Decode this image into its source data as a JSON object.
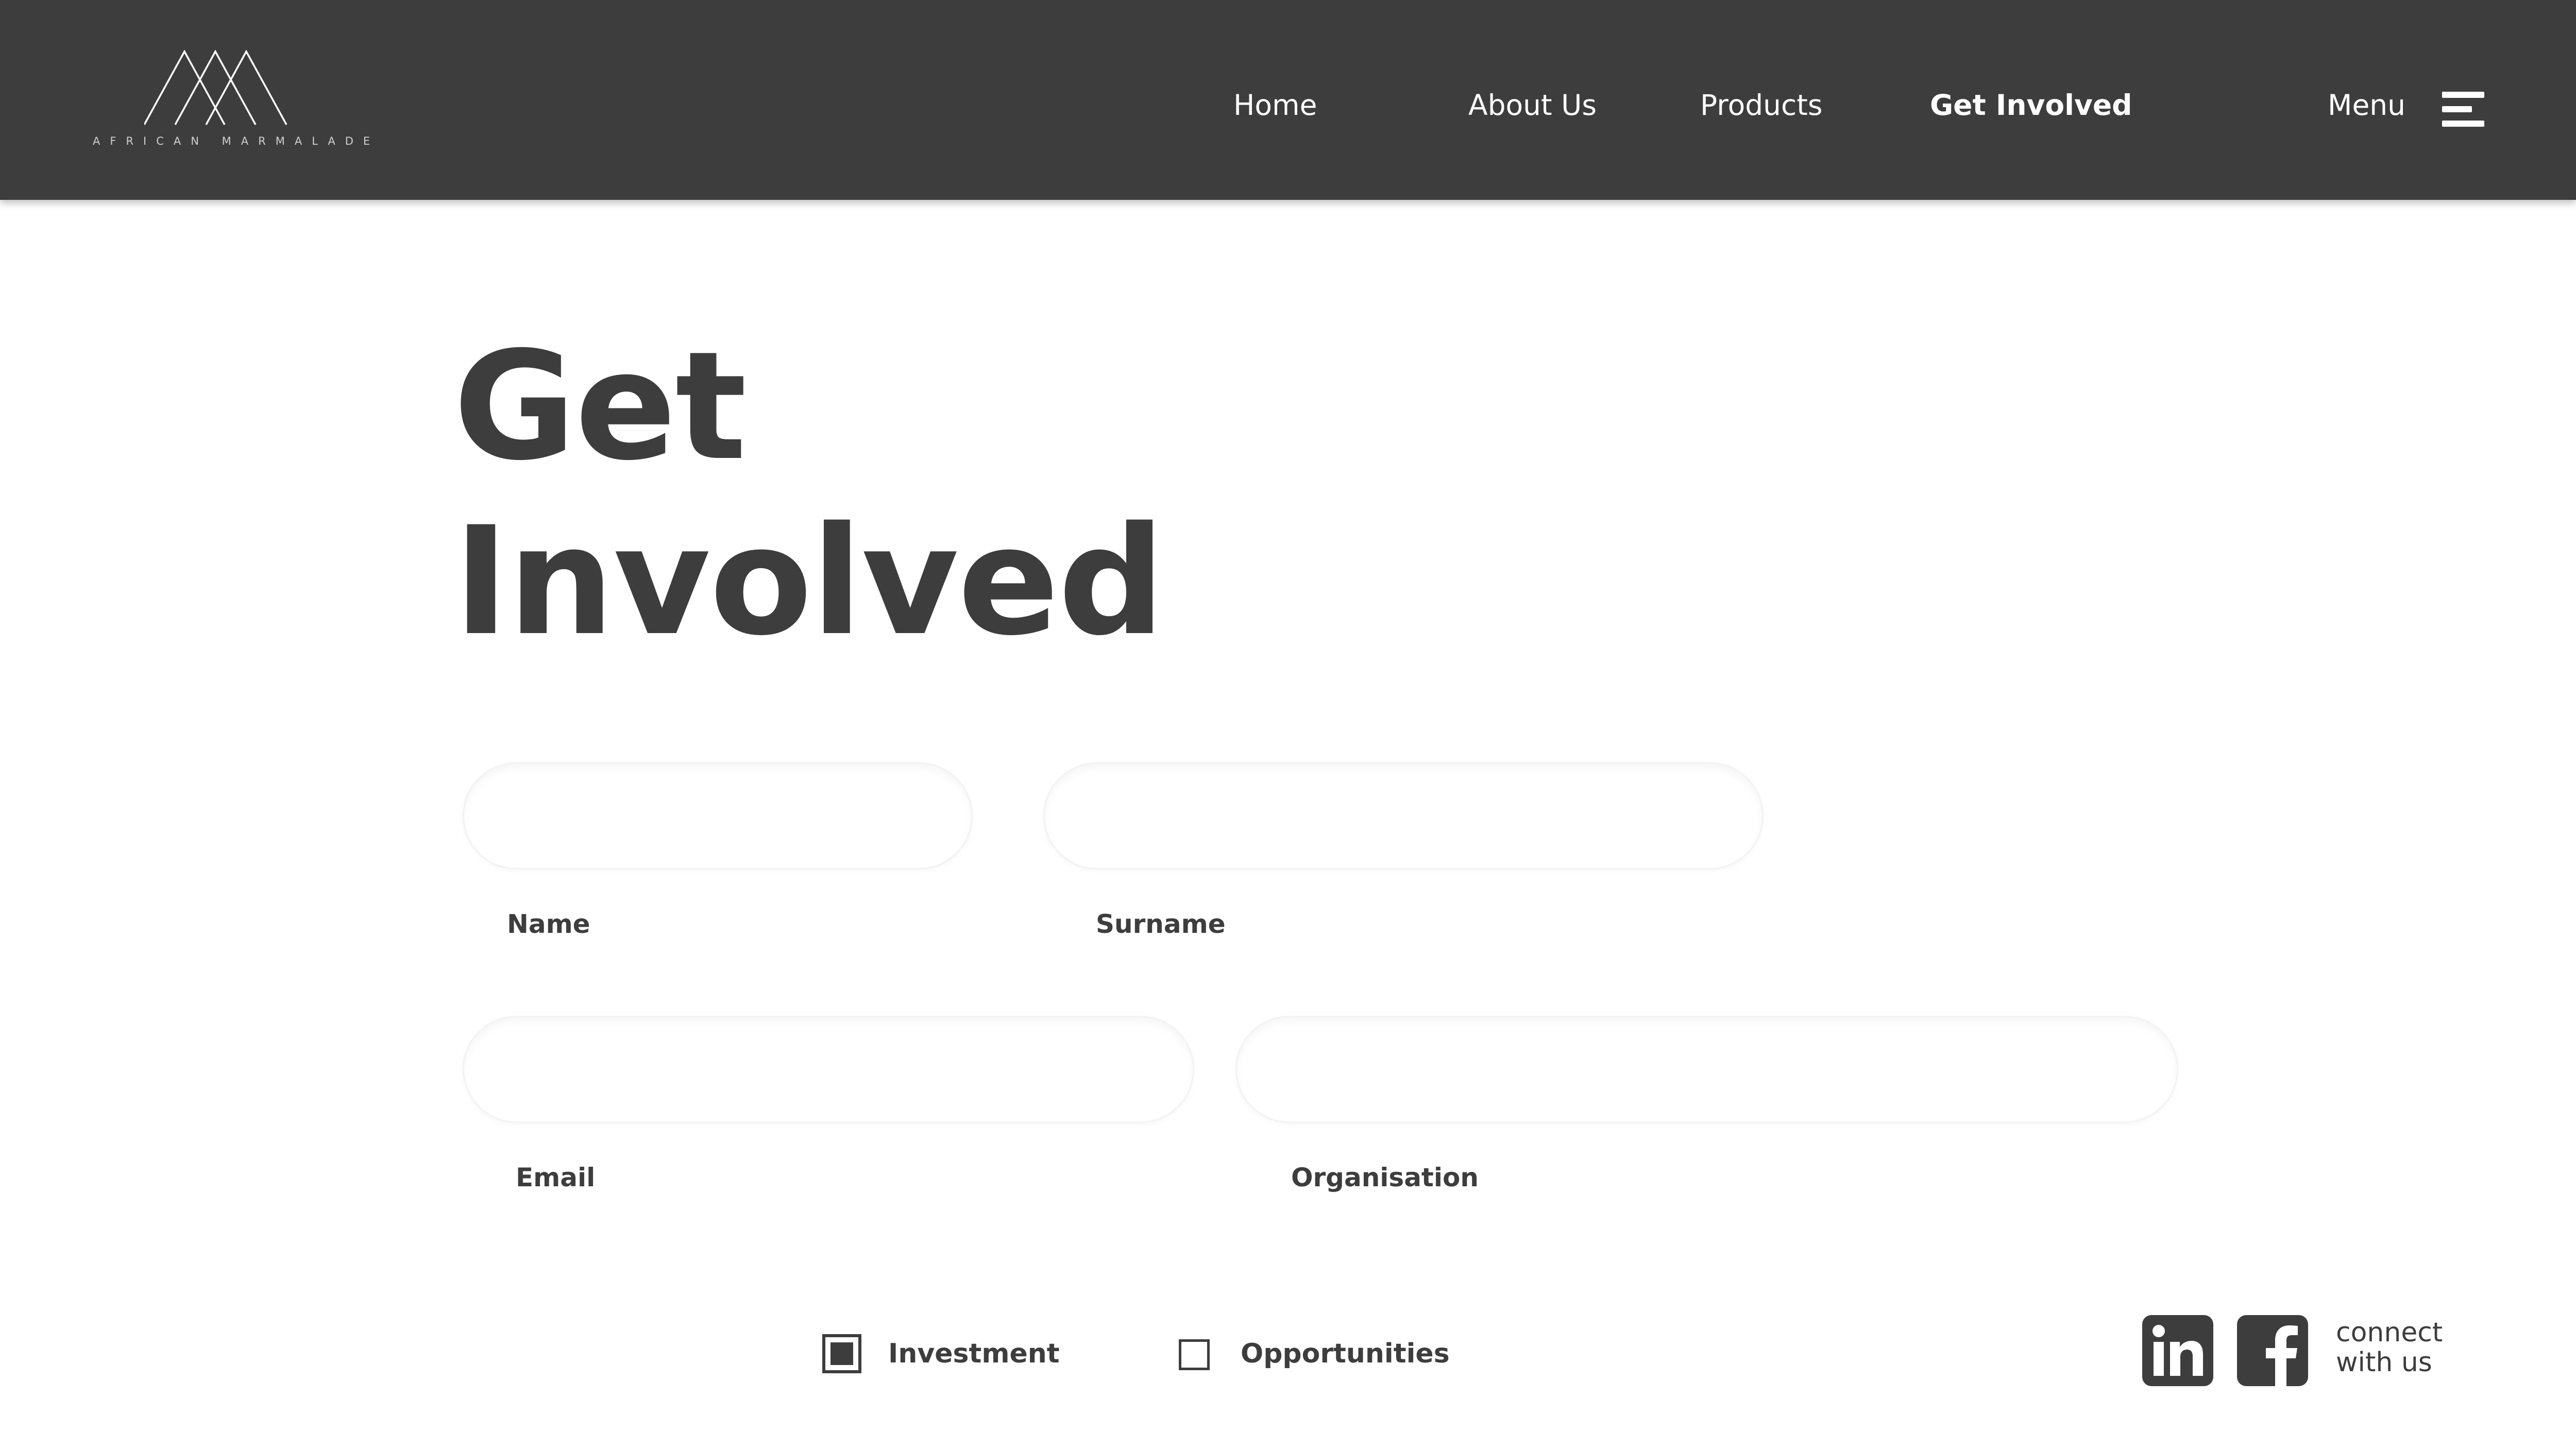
{
  "header": {
    "logo": {
      "icon": "mountain-peaks-icon",
      "text": "AFRICAN MARMALADE"
    },
    "nav": [
      {
        "label": "Home",
        "active": false
      },
      {
        "label": "About Us",
        "active": false
      },
      {
        "label": "Products",
        "active": false
      },
      {
        "label": "Get Involved",
        "active": true
      }
    ],
    "menu": {
      "label": "Menu",
      "icon": "hamburger-menu-icon"
    }
  },
  "page": {
    "title_line1": "Get",
    "title_line2": "Involved"
  },
  "form": {
    "fields": [
      {
        "name": "name",
        "label": "Name",
        "value": ""
      },
      {
        "name": "surname",
        "label": "Surname",
        "value": ""
      },
      {
        "name": "email",
        "label": "Email",
        "value": ""
      },
      {
        "name": "organisation",
        "label": "Organisation",
        "value": ""
      }
    ],
    "checkboxes": [
      {
        "label": "Investment",
        "checked": true
      },
      {
        "label": "Opportunities",
        "checked": false
      }
    ]
  },
  "social": {
    "icons": [
      "linkedin-icon",
      "facebook-icon"
    ],
    "connect_line1": "connect",
    "connect_line2": "with us"
  },
  "colors": {
    "header_bg": "#3d3d3d",
    "text_dark": "#3d3d3d",
    "nav_text": "#ffffff",
    "page_bg": "#ffffff"
  }
}
